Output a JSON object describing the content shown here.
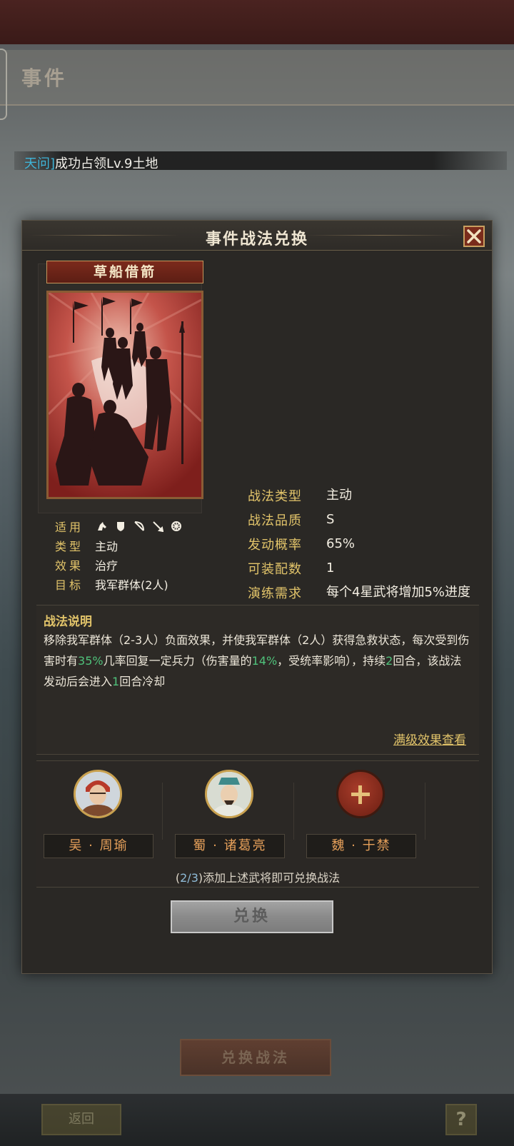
{
  "background": {
    "page_title": "事件",
    "notice_who": "天问]",
    "notice_text": "成功占领Lv.9土地",
    "exchange_tactic_button": "兑换战法",
    "back_button": "返回",
    "help_button": "?"
  },
  "dialog": {
    "title": "事件战法兑换",
    "card": {
      "name": "草船借箭"
    },
    "left_info": {
      "applies_label": "适用",
      "troop_icons": [
        "cavalry-icon",
        "shield-icon",
        "bow-icon",
        "spear-icon",
        "siege-icon"
      ],
      "type_label": "类型",
      "type_value": "主动",
      "effect_label": "效果",
      "effect_value": "治疗",
      "target_label": "目标",
      "target_value": "我军群体(2人)"
    },
    "right_info": {
      "tactic_type_label": "战法类型",
      "tactic_type_value": "主动",
      "tactic_quality_label": "战法品质",
      "tactic_quality_value": "S",
      "trigger_rate_label": "发动概率",
      "trigger_rate_value": "65%",
      "equip_count_label": "可装配数",
      "equip_count_value": "1",
      "practice_label": "演练需求",
      "practice_value": "每个4星武将增加5%进度"
    },
    "description": {
      "title": "战法说明",
      "part1": "移除我军群体（2-3人）负面效果，并使我军群体（2人）获得急救状态，每次受到伤害时有",
      "hl1": "35%",
      "part2": "几率回复一定兵力（伤害量的",
      "hl2": "14%",
      "part3": "，受统率影响），持续",
      "hl3": "2",
      "part4": "回合，该战法发动后会进入",
      "hl4": "1",
      "part5": "回合冷却",
      "full_level_link": "满级效果查看"
    },
    "generals": {
      "slots": [
        {
          "name": "吴 · 周瑜"
        },
        {
          "name": "蜀 · 诸葛亮"
        },
        {
          "name": "魏 · 于禁"
        }
      ],
      "hint_open": "(",
      "hint_count": "2/3",
      "hint_close": ")添加上述武将即可兑换战法"
    },
    "exchange_button": "兑换"
  },
  "colors": {
    "gold_label": "#e2c46a",
    "highlight_green": "#4fc17a",
    "general_name_orange": "#e6a05a",
    "close_red": "#7a2c1c"
  }
}
